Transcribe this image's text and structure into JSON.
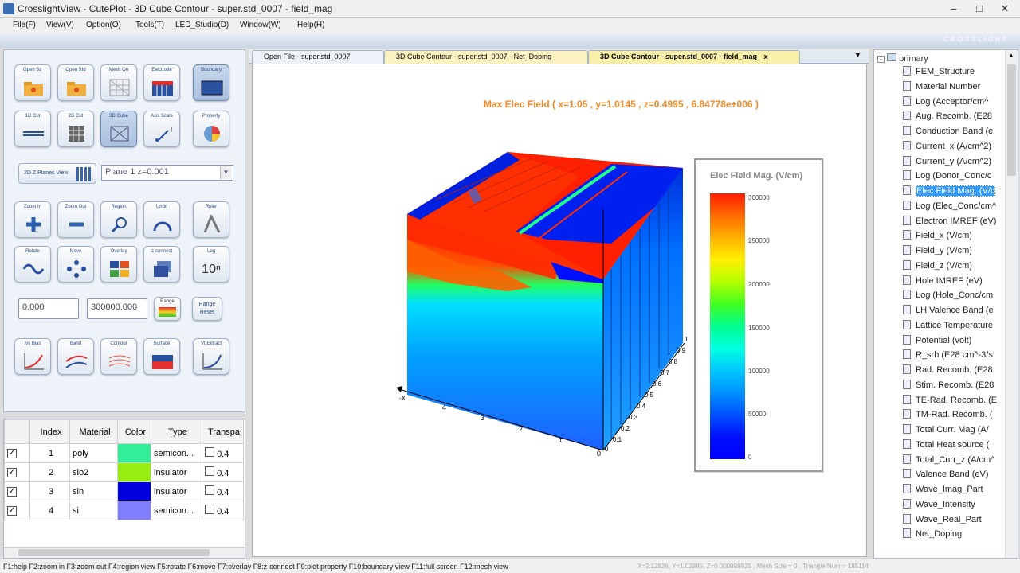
{
  "window": {
    "title": "CrosslightView - CutePlot - 3D Cube Contour - super.std_0007 - field_mag"
  },
  "menu": [
    "File(F)",
    "View(V)",
    "Option(O)",
    "Tools(T)",
    "LED_Studio(D)",
    "Window(W)",
    "Help(H)"
  ],
  "brand": "CROSSLIGHT",
  "toolbar": {
    "row1": [
      "Open Str",
      "Open Std",
      "Mesh On",
      "Electrode",
      "Boundary"
    ],
    "row2": [
      "1D Cut",
      "2D Cut",
      "3D Cube",
      "Axis Scale",
      "Property"
    ],
    "planes_button": "2D Z Planes View",
    "plane_select": "Plane 1   z=0.001",
    "row3": [
      "Zoom In",
      "Zoom Out",
      "Region",
      "Undo",
      "Ruler"
    ],
    "row4": [
      "Rotate",
      "Move",
      "Overlay",
      "z-connect",
      "Log"
    ],
    "log_text": "10ⁿ",
    "range_min": "0.000",
    "range_max": "300000.000",
    "range_label": "Range",
    "range_reset": "Range Reset",
    "row5": [
      "Ivs Bias",
      "Band",
      "Contour",
      "Surface",
      "Vt Extract"
    ]
  },
  "material_table": {
    "headers": [
      "",
      "Index",
      "Material",
      "Color",
      "Type",
      "Transpa"
    ],
    "rows": [
      {
        "index": "1",
        "material": "poly",
        "color": "#33ee99",
        "type": "semicon...",
        "transp": "0.4"
      },
      {
        "index": "2",
        "material": "sio2",
        "color": "#99ee11",
        "type": "insulator",
        "transp": "0.4"
      },
      {
        "index": "3",
        "material": "sin",
        "color": "#0000dd",
        "type": "insulator",
        "transp": "0.4"
      },
      {
        "index": "4",
        "material": "si",
        "color": "#7f7fff",
        "type": "semicon...",
        "transp": "0.4"
      }
    ]
  },
  "tabs": [
    "Open File - super.std_0007",
    "3D Cube Contour - super.std_0007 - Net_Doping",
    "3D Cube Contour - super.std_0007 - field_mag"
  ],
  "plot": {
    "title": "Max Elec Field ( x=1.05 , y=1.0145 , z=0.4995 , 6.84778e+006 )",
    "legend_title": "Elec Field Mag. (V/cm)",
    "legend_ticks": [
      "300000",
      "250000",
      "200000",
      "150000",
      "100000",
      "50000",
      "0"
    ],
    "x_axis_ticks": [
      "4",
      "3",
      "2",
      "1",
      "0"
    ],
    "x_axis_label": "-X",
    "z_axis_ticks": [
      "1",
      "0.9",
      "0.8",
      "0.7",
      "0.6",
      "0.5",
      "0.4",
      "0.3",
      "0.2",
      "0.1",
      "0"
    ]
  },
  "tree": {
    "root": "primary",
    "items": [
      "FEM_Structure",
      "Material Number",
      "Log (Acceptor/cm^",
      "Aug. Recomb. (E28",
      "Conduction Band (e",
      "Current_x (A/cm^2)",
      "Current_y (A/cm^2)",
      "Log (Donor_Conc/c",
      "Elec Field Mag. (V/c",
      "Log (Elec_Conc/cm^",
      "Electron IMREF (eV)",
      "Field_x (V/cm)",
      "Field_y (V/cm)",
      "Field_z (V/cm)",
      "Hole IMREF (eV)",
      "Log (Hole_Conc/cm",
      "LH Valence Band (e",
      "Lattice Temperature",
      "Potential (volt)",
      "R_srh (E28 cm^-3/s",
      "Rad. Recomb. (E28",
      "Stim. Recomb. (E28",
      "TE-Rad. Recomb. (E",
      "TM-Rad. Recomb. (",
      "Total Curr. Mag (A/",
      "Total Heat source (",
      "Total_Curr_z (A/cm^",
      "Valence  Band (eV)",
      "Wave_Imag_Part",
      "Wave_Intensity",
      "Wave_Real_Part",
      "Net_Doping"
    ],
    "selected": "Elec Field Mag. (V/c"
  },
  "status": {
    "keys": "F1:help  F2:zoom in  F3:zoom out  F4:region view  F5:rotate  F6:move  F7:overlay  F8:z-connect  F9:plot property  F10:boundary view  F11:full screen  F12:mesh view",
    "coords": "X=2.12826, Y=1.02885, Z=0.000999925 , Mesh Size = 0 , Triangle Num = 185114"
  }
}
